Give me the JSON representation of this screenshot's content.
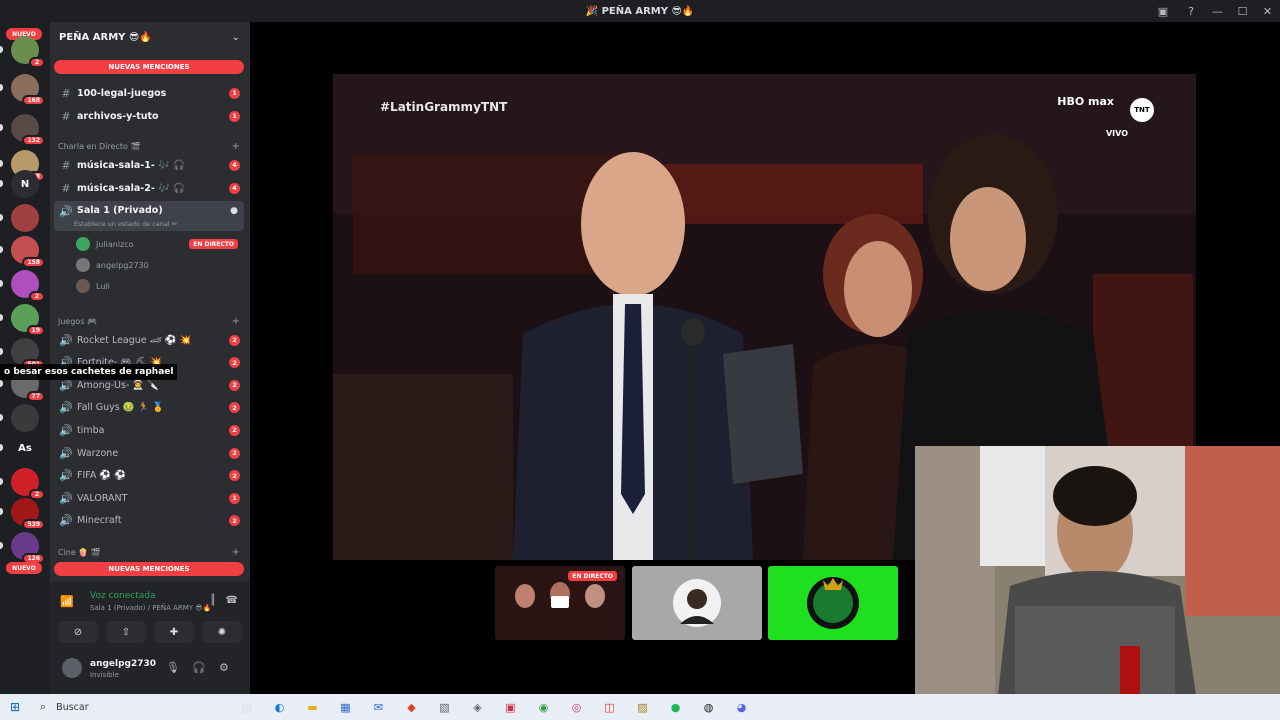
{
  "window": {
    "title": "🎉 PEÑA ARMY 😎🔥"
  },
  "rail": {
    "nuevo_top": "NUEVO",
    "nuevo_bottom": "NUEVO",
    "servers": [
      {
        "badge": "2",
        "color": "#6b8e4e"
      },
      {
        "badge": "168",
        "color": "#8a6d5a"
      },
      {
        "badge": "132",
        "color": "#5a4a46"
      },
      {
        "badge": "98",
        "color": "#b89a6a"
      },
      {
        "badge": "",
        "label": "N",
        "color": "#2b2d31"
      },
      {
        "badge": "",
        "color": "#a04040"
      },
      {
        "badge": "158",
        "color": "#c25050"
      },
      {
        "badge": "2",
        "color": "#b04ec0"
      },
      {
        "badge": "19",
        "color": "#5aa05a"
      },
      {
        "badge": "501",
        "color": "#404040"
      },
      {
        "badge": "77",
        "color": "#6a6a6a"
      },
      {
        "badge": "",
        "color": "#3a3a3a"
      },
      {
        "badge": "",
        "label": "As",
        "color": "#1e1f22"
      },
      {
        "badge": "2",
        "color": "#d0202a"
      },
      {
        "badge": "539",
        "color": "#a01818"
      },
      {
        "badge": "126",
        "color": "#6a3a8a"
      },
      {
        "badge": "",
        "color": "#5a5ac0"
      }
    ]
  },
  "sidebar": {
    "guild_name": "PEÑA ARMY 😎🔥",
    "mentions_top": "NUEVAS MENCIONES",
    "mentions_bottom": "NUEVAS MENCIONES",
    "text_channels": [
      {
        "name": "100-legal-juegos",
        "count": "1"
      },
      {
        "name": "archivos-y-tuto",
        "count": "1"
      }
    ],
    "cat_live": "Charla en Directo 🎬",
    "live_channels": [
      {
        "name": "música-sala-1- 🎶 🎧",
        "count": "4"
      },
      {
        "name": "música-sala-2- 🎶 🎧",
        "count": "4"
      }
    ],
    "active_channel": "Sala 1 (Privado)",
    "active_status": "Establece un estado de canal ✏",
    "voice_users": [
      {
        "name": "Julianlzco",
        "live": "EN DIRECTO",
        "color": "#3ba55d"
      },
      {
        "name": "angelpg2730",
        "live": "",
        "color": "#777"
      },
      {
        "name": "Luli",
        "live": "",
        "color": "#6a5a52"
      }
    ],
    "cat_games": "Juegos 🎮",
    "game_channels": [
      {
        "name": "Rocket League 🏎 ⚽ 💥",
        "count": "2"
      },
      {
        "name": "Fortnite- 🎮 ⛏ 💥",
        "count": "2"
      },
      {
        "name": "Among-Us- 👨‍🚀 🔪",
        "count": "2"
      },
      {
        "name": "Fall Guys 🤢 🏃 🏅",
        "count": "2"
      },
      {
        "name": "timba",
        "count": "2"
      },
      {
        "name": "Warzone",
        "count": "2"
      },
      {
        "name": "FIFA ⚽ ⚽",
        "count": "2"
      },
      {
        "name": "VALORANT",
        "count": "1"
      },
      {
        "name": "Minecraft",
        "count": "2"
      }
    ],
    "cat_cine": "Cine 🍿 🎬"
  },
  "voice": {
    "status": "Voz conectada",
    "location": "Sala 1 (Privado) / PEÑA ARMY 😎🔥"
  },
  "user": {
    "name": "angelpg2730",
    "status": "Invisible"
  },
  "stream": {
    "hashtag": "#LatinGrammyTNT",
    "network": "HBO max",
    "tnt": "TNT",
    "live_word": "VIVO",
    "thumb_live": "EN DIRECTO"
  },
  "caption": "o besar esos cachetes de raphael",
  "taskbar": {
    "search": "Buscar"
  },
  "colors": {
    "accent_red": "#f23f43",
    "online_green": "#23a55a",
    "sidebar_bg": "#2b2d31",
    "rail_bg": "#1e1f22"
  }
}
